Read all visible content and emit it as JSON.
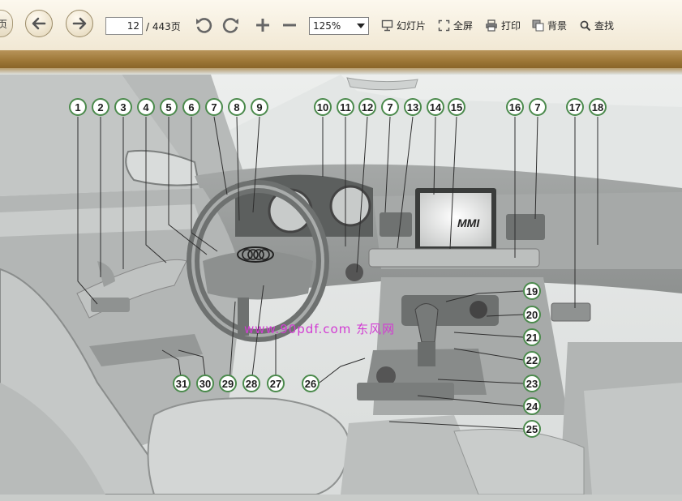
{
  "toolbar": {
    "prev_page_tab": "页",
    "page_number": "12",
    "page_total": "/ 443页",
    "zoom": "125%",
    "slideshow_label": "幻灯片",
    "fullscreen_label": "全屏",
    "print_label": "打印",
    "background_label": "背景",
    "find_label": "查找"
  },
  "document": {
    "watermark": "www.90pdf.com  东风网",
    "screen_logo": "MMI",
    "callouts": [
      "1",
      "2",
      "3",
      "4",
      "5",
      "6",
      "7",
      "8",
      "9",
      "10",
      "11",
      "12",
      "7",
      "13",
      "14",
      "15",
      "16",
      "7",
      "17",
      "18",
      "19",
      "20",
      "21",
      "22",
      "23",
      "24",
      "25",
      "26",
      "27",
      "28",
      "29",
      "30",
      "31"
    ]
  },
  "colors": {
    "toolbar_bg": "#f4ecd9",
    "brown_strip": "#9c7636",
    "callout_border": "#4b8a4c",
    "watermark": "#d23bd3"
  }
}
